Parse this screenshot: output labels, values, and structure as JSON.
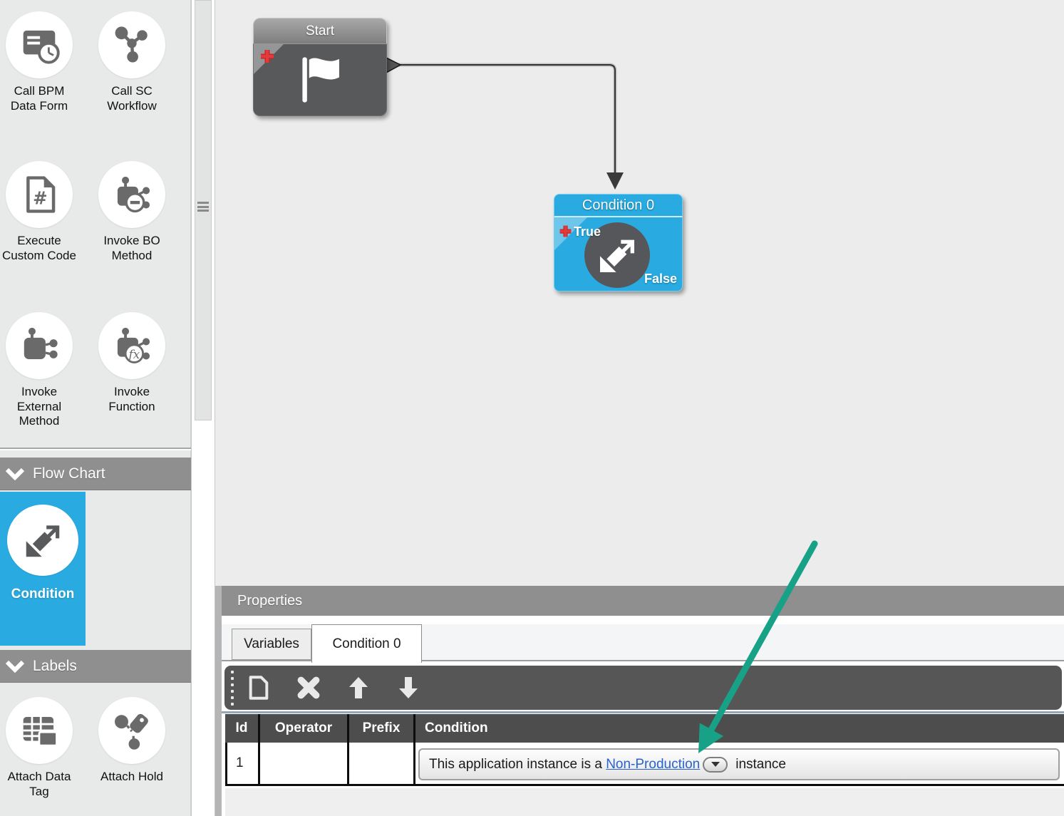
{
  "palette": {
    "tools": [
      {
        "label": "Call BPM Data Form",
        "icon": "bpm-data-form-icon"
      },
      {
        "label": "Call SC Workflow",
        "icon": "sc-workflow-icon"
      },
      {
        "label": "Execute Custom Code",
        "icon": "custom-code-icon"
      },
      {
        "label": "Invoke BO Method",
        "icon": "bo-method-icon"
      },
      {
        "label": "Invoke External Method",
        "icon": "external-method-icon"
      },
      {
        "label": "Invoke Function",
        "icon": "function-icon"
      }
    ],
    "sections": [
      {
        "header": "Flow Chart"
      },
      {
        "header": "Labels"
      }
    ],
    "flow_items": [
      {
        "label": "Condition",
        "selected": true
      }
    ],
    "label_items": [
      {
        "label": "Attach Data Tag",
        "icon": "data-tag-icon"
      },
      {
        "label": "Attach Hold",
        "icon": "hold-tag-icon"
      }
    ]
  },
  "canvas": {
    "start_node": {
      "title": "Start"
    },
    "condition_node": {
      "title": "Condition 0",
      "true_label": "True",
      "false_label": "False"
    }
  },
  "properties": {
    "title": "Properties",
    "tabs": [
      {
        "label": "Variables",
        "active": false
      },
      {
        "label": "Condition 0",
        "active": true
      }
    ],
    "toolbar_icons": [
      "new-document-icon",
      "delete-icon",
      "move-up-icon",
      "move-down-icon"
    ],
    "table": {
      "columns": [
        "Id",
        "Operator",
        "Prefix",
        "Condition"
      ],
      "row": {
        "id": "1",
        "operator": "",
        "prefix": "",
        "condition_text_before": "This application instance is a",
        "condition_link": "Non-Production",
        "condition_text_after": "instance"
      }
    }
  },
  "icons": {
    "chevron-down-icon": "v-chevron shape",
    "dropdown-caret-icon": "▼",
    "start-flag-icon": "⚑",
    "condition-arrows-icon": "⇄",
    "add-marker-icon": "+",
    "new-document-icon": "page outline",
    "delete-icon": "✕",
    "move-up-icon": "⬆",
    "move-down-icon": "⬇",
    "grip-icon": "⋮ drag dots"
  },
  "colors": {
    "accent_blue": "#29abe2",
    "node_gray": "#58595b",
    "link_blue": "#2a63cc",
    "annotation_green": "#17a287",
    "section_header_gray": "#8f8f8f",
    "table_header_gray": "#4d4d4d",
    "marker_red": "#cf2525"
  }
}
